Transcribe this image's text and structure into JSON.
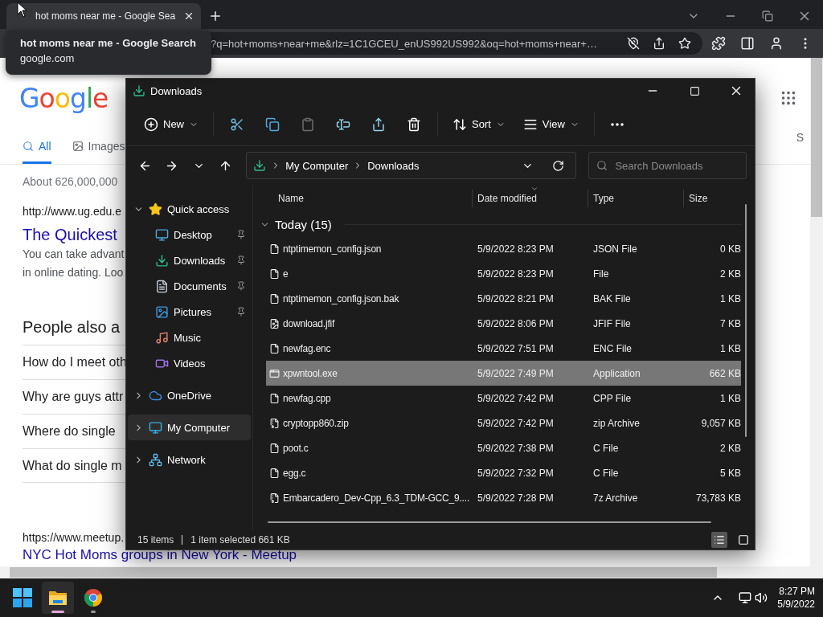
{
  "browser": {
    "tab": {
      "title": "hot moms near me - Google Sea",
      "selected": true
    },
    "address": "?q=hot+moms+near+me&rlz=1C1GCEU_enUS992US992&oq=hot+moms+near+…",
    "tooltip": {
      "title": "hot moms near me - Google Search",
      "domain": "google.com"
    }
  },
  "google": {
    "logo": "Google",
    "tabs": [
      {
        "label": "All",
        "selected": true
      },
      {
        "label": "Images",
        "selected": false
      }
    ],
    "right_tab": "S",
    "result_count": "About 626,000,000",
    "result": {
      "url": "http://www.ug.edu.e",
      "title": "The Quickest",
      "snippet": [
        "You can take advant",
        "in online dating. Loo"
      ]
    },
    "people_also_ask": {
      "heading": "People also a",
      "questions": [
        "How do I meet oth",
        "Why are guys attr",
        "Where do single",
        "What do single m"
      ]
    },
    "result_2": {
      "url": "https://www.meetup.",
      "title": "NYC Hot Moms groups in New York - Meetup"
    }
  },
  "explorer": {
    "title": "Downloads",
    "commands": [
      {
        "kind": "new",
        "label": "New",
        "disabled": false
      },
      {
        "kind": "cut",
        "disabled": false
      },
      {
        "kind": "copy",
        "disabled": false
      },
      {
        "kind": "paste",
        "disabled": true
      },
      {
        "kind": "rename",
        "disabled": false
      },
      {
        "kind": "share",
        "disabled": false
      },
      {
        "kind": "delete",
        "disabled": false
      },
      {
        "kind": "sort",
        "label": "Sort",
        "disabled": false
      },
      {
        "kind": "view",
        "label": "View",
        "disabled": false
      },
      {
        "kind": "more",
        "disabled": false
      }
    ],
    "breadcrumbs": [
      "My Computer",
      "Downloads"
    ],
    "search": {
      "placeholder": "Search Downloads"
    },
    "nav": [
      {
        "label": "Quick access",
        "kind": "star",
        "expanded": true,
        "selected": false,
        "children": [
          {
            "label": "Desktop",
            "kind": "desktop",
            "pinned": true,
            "selected": false
          },
          {
            "label": "Downloads",
            "kind": "download",
            "pinned": true,
            "selected": false
          },
          {
            "label": "Documents",
            "kind": "document",
            "pinned": true,
            "selected": false
          },
          {
            "label": "Pictures",
            "kind": "picture",
            "pinned": true,
            "selected": false
          },
          {
            "label": "Music",
            "kind": "music",
            "pinned": false,
            "selected": false
          },
          {
            "label": "Videos",
            "kind": "video",
            "pinned": false,
            "selected": false
          }
        ]
      },
      {
        "label": "OneDrive",
        "kind": "cloud",
        "expanded": false,
        "selected": false
      },
      {
        "label": "My Computer",
        "kind": "computer",
        "expanded": false,
        "selected": true
      },
      {
        "label": "Network",
        "kind": "network",
        "expanded": false,
        "selected": false
      }
    ],
    "list": {
      "columns": [
        {
          "label": "Name",
          "sorted": false
        },
        {
          "label": "Date modified",
          "sorted": true
        },
        {
          "label": "Type",
          "sorted": false
        },
        {
          "label": "Size",
          "sorted": false
        }
      ],
      "group": {
        "label": "Today (15)",
        "expanded": true
      },
      "files": [
        {
          "name": "ntptimemon_config.json",
          "date": "5/9/2022 8:23 PM",
          "type": "JSON File",
          "size": "0 KB",
          "kind": "file",
          "selected": false
        },
        {
          "name": "e",
          "date": "5/9/2022 8:23 PM",
          "type": "File",
          "size": "2 KB",
          "kind": "file",
          "selected": false
        },
        {
          "name": "ntptimemon_config.json.bak",
          "date": "5/9/2022 8:21 PM",
          "type": "BAK File",
          "size": "1 KB",
          "kind": "file",
          "selected": false
        },
        {
          "name": "download.jfif",
          "date": "5/9/2022 8:06 PM",
          "type": "JFIF File",
          "size": "7 KB",
          "kind": "image",
          "selected": false
        },
        {
          "name": "newfag.enc",
          "date": "5/9/2022 7:51 PM",
          "type": "ENC File",
          "size": "1 KB",
          "kind": "file",
          "selected": false
        },
        {
          "name": "xpwntool.exe",
          "date": "5/9/2022 7:49 PM",
          "type": "Application",
          "size": "662 KB",
          "kind": "app",
          "selected": true
        },
        {
          "name": "newfag.cpp",
          "date": "5/9/2022 7:42 PM",
          "type": "CPP File",
          "size": "1 KB",
          "kind": "file",
          "selected": false
        },
        {
          "name": "cryptopp860.zip",
          "date": "5/9/2022 7:42 PM",
          "type": "zip Archive",
          "size": "9,057 KB",
          "kind": "zip",
          "selected": false
        },
        {
          "name": "poot.c",
          "date": "5/9/2022 7:38 PM",
          "type": "C File",
          "size": "2 KB",
          "kind": "file",
          "selected": false
        },
        {
          "name": "egg.c",
          "date": "5/9/2022 7:32 PM",
          "type": "C File",
          "size": "5 KB",
          "kind": "file",
          "selected": false
        },
        {
          "name": "Embarcadero_Dev-Cpp_6.3_TDM-GCC_9....",
          "date": "5/9/2022 7:28 PM",
          "type": "7z Archive",
          "size": "73,783 KB",
          "kind": "zip",
          "selected": false
        }
      ]
    },
    "status": {
      "count": "15 items",
      "selection": "1 item selected 661 KB",
      "views": [
        {
          "kind": "details",
          "selected": true
        },
        {
          "kind": "tiles",
          "selected": false
        }
      ]
    }
  },
  "taskbar": {
    "apps": [
      {
        "kind": "explorer",
        "active": true
      },
      {
        "kind": "chrome",
        "active": false
      }
    ],
    "time": "8:27 PM",
    "date": "5/9/2022"
  }
}
